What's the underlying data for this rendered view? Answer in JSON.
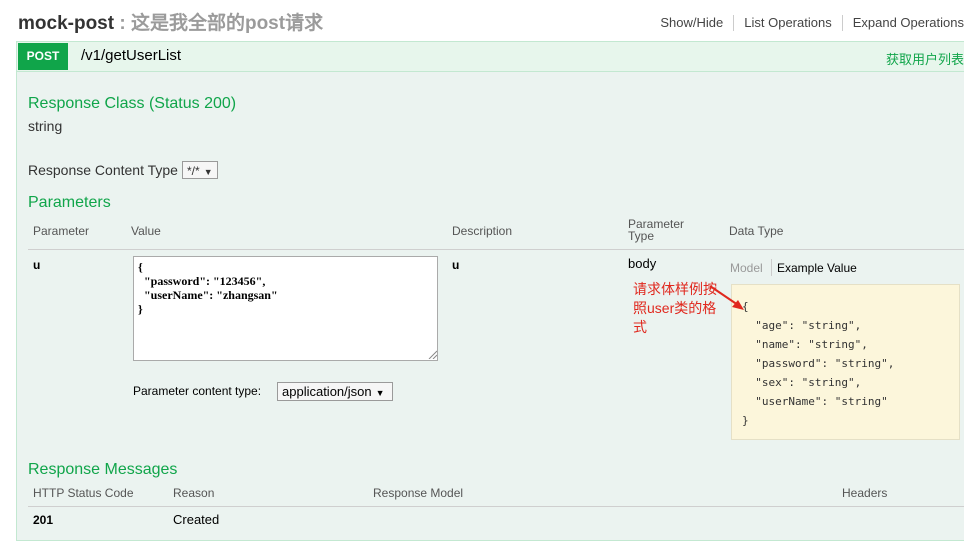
{
  "resource": {
    "name": "mock-post",
    "description": "这是我全部的post请求",
    "operations": [
      "Show/Hide",
      "List Operations",
      "Expand Operations"
    ]
  },
  "operation": {
    "method": "POST",
    "path": "/v1/getUserList",
    "summary": "获取用户列表"
  },
  "response_class": {
    "heading": "Response Class (Status 200)",
    "value": "string"
  },
  "response_content_type": {
    "label": "Response Content Type",
    "selected": "*/*"
  },
  "parameters": {
    "heading": "Parameters",
    "columns": [
      "Parameter",
      "Value",
      "Description",
      "Parameter\nType",
      "Data Type"
    ],
    "row": {
      "name": "u",
      "value_lines": [
        "{",
        "  \"password\": \"123456\",",
        "  \"userName\": \"zhangsan\"",
        "}"
      ],
      "description": "u",
      "param_type": "body"
    },
    "content_type_label": "Parameter content type:",
    "content_type_selected": "application/json",
    "model_tabs": [
      "Model",
      "Example Value"
    ],
    "example_lines": [
      "{",
      "  \"age\": \"string\",",
      "  \"name\": \"string\",",
      "  \"password\": \"string\",",
      "  \"sex\": \"string\",",
      "  \"userName\": \"string\"",
      "}"
    ]
  },
  "annotation": {
    "text": "请求体样例按照user类的格式",
    "color": "#e0281e"
  },
  "response_messages": {
    "heading": "Response Messages",
    "columns": [
      "HTTP Status Code",
      "Reason",
      "Response Model",
      "Headers"
    ],
    "rows": [
      {
        "code": "201",
        "reason": "Created"
      }
    ]
  },
  "colors": {
    "accent": "#10a54a",
    "panel_bg": "#ebf3f0",
    "example_bg": "#fcf6db"
  }
}
